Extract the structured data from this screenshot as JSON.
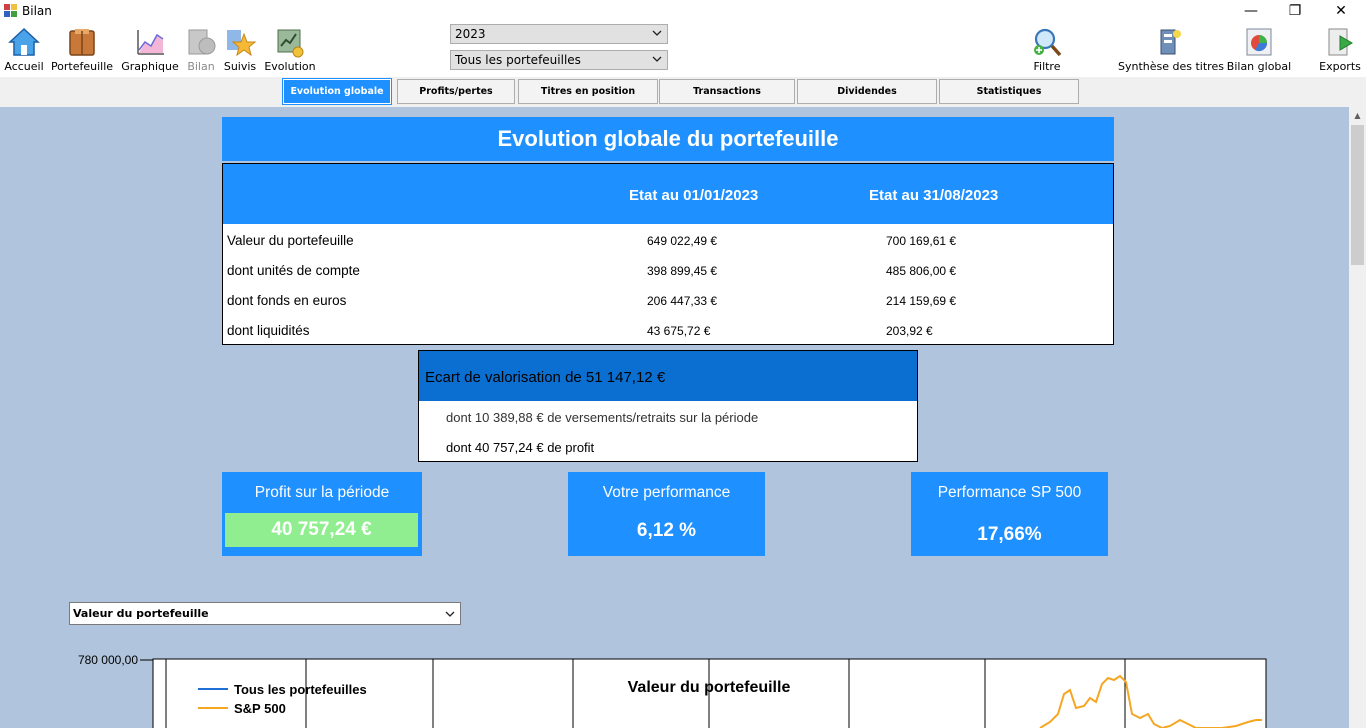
{
  "window": {
    "title": "Bilan",
    "minimize": "—",
    "restore": "❐",
    "close": "✕"
  },
  "toolbar": {
    "left_buttons": [
      {
        "label": "Accueil",
        "icon": "home-icon",
        "disabled": false
      },
      {
        "label": "Portefeuille",
        "icon": "portfolio-icon",
        "disabled": false
      },
      {
        "label": "Graphique",
        "icon": "chart-icon",
        "disabled": false
      },
      {
        "label": "Bilan",
        "icon": "balance-icon",
        "disabled": true
      },
      {
        "label": "Suivis",
        "icon": "star-icon",
        "disabled": false
      },
      {
        "label": "Evolution",
        "icon": "evolution-icon",
        "disabled": false
      }
    ],
    "year_select": "2023",
    "portfolio_select": "Tous les portefeuilles",
    "filter": {
      "label": "Filtre",
      "icon": "filter-search-icon"
    },
    "right_buttons": [
      {
        "label": "Synthèse des titres",
        "icon": "securities-summary-icon"
      },
      {
        "label": "Bilan global",
        "icon": "global-balance-icon"
      },
      {
        "label": "Exports",
        "icon": "export-icon"
      }
    ]
  },
  "tabs": [
    "Evolution globale",
    "Profits/pertes",
    "Titres en position",
    "Transactions",
    "Dividendes",
    "Statistiques"
  ],
  "active_tab": 0,
  "main": {
    "title": "Evolution globale du portefeuille",
    "col_start": "Etat au 01/01/2023",
    "col_end": "Etat au 31/08/2023",
    "rows": [
      {
        "label": "Valeur du portefeuille",
        "start": "649 022,49 €",
        "end": "700 169,61 €"
      },
      {
        "label": "dont unités de compte",
        "start": "398 899,45 €",
        "end": "485 806,00 €"
      },
      {
        "label": "dont fonds en euros",
        "start": "206 447,33 €",
        "end": "214 159,69 €"
      },
      {
        "label": "dont liquidités",
        "start": "43 675,72 €",
        "end": "203,92 €"
      }
    ]
  },
  "ecart": {
    "title": "Ecart de valorisation de 51 147,12 €",
    "line1": "dont 10 389,88 € de versements/retraits sur la période",
    "line2": "dont 40 757,24 € de profit"
  },
  "cards": {
    "profit": {
      "title": "Profit sur la période",
      "value": "40 757,24 €"
    },
    "perf": {
      "title": "Votre performance",
      "value": "6,12 %"
    },
    "sp": {
      "title": "Performance SP 500",
      "value": "17,66%"
    }
  },
  "colors": {
    "accent": "#1e90ff",
    "header_dark": "#0a6fd0",
    "profit_green": "#90ee90",
    "background": "#b0c4de",
    "series_portfolio": "#1f6fd6",
    "series_sp": "#f5a623"
  },
  "chart_select": "Valeur du portefeuille",
  "chart_data": {
    "type": "line",
    "title": "Valeur du portefeuille",
    "y_tick_labels": [
      "780 000,00"
    ],
    "series": [
      {
        "name": "Tous les portefeuilles",
        "values": []
      },
      {
        "name": "S&P 500",
        "values": []
      }
    ],
    "legend": "top-left",
    "grid": true
  }
}
